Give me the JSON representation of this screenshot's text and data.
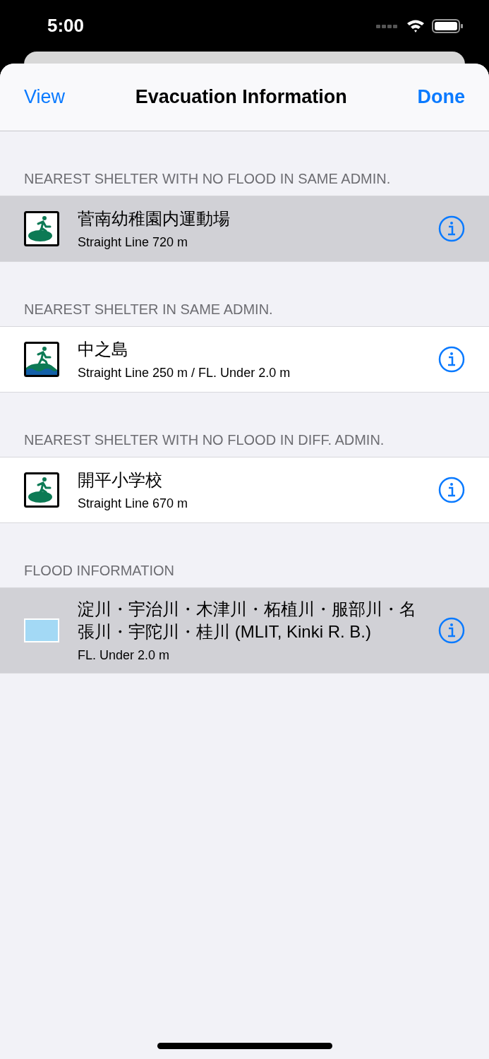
{
  "status_bar": {
    "time": "5:00"
  },
  "nav": {
    "left": "View",
    "title": "Evacuation Information",
    "right": "Done"
  },
  "sections": [
    {
      "header": "NEAREST SHELTER WITH NO FLOOD IN SAME ADMIN.",
      "rows": [
        {
          "kind": "shelter",
          "flooded": false,
          "selected": true,
          "title": "菅南幼稚園内運動場",
          "subtitle": "Straight Line 720 m"
        }
      ]
    },
    {
      "header": "NEAREST SHELTER IN SAME ADMIN.",
      "rows": [
        {
          "kind": "shelter",
          "flooded": true,
          "selected": false,
          "title": "中之島",
          "subtitle": "Straight Line 250 m / FL. Under 2.0 m"
        }
      ]
    },
    {
      "header": "NEAREST SHELTER WITH NO FLOOD IN DIFF. ADMIN.",
      "rows": [
        {
          "kind": "shelter",
          "flooded": false,
          "selected": false,
          "title": "開平小学校",
          "subtitle": "Straight Line 670 m"
        }
      ]
    },
    {
      "header": "FLOOD INFORMATION",
      "rows": [
        {
          "kind": "flood",
          "color": "#a3d9f5",
          "selected": true,
          "title": "淀川・宇治川・木津川・柘植川・服部川・名張川・宇陀川・桂川 (MLIT, Kinki R. B.)",
          "subtitle": "FL. Under 2.0 m"
        }
      ]
    }
  ]
}
